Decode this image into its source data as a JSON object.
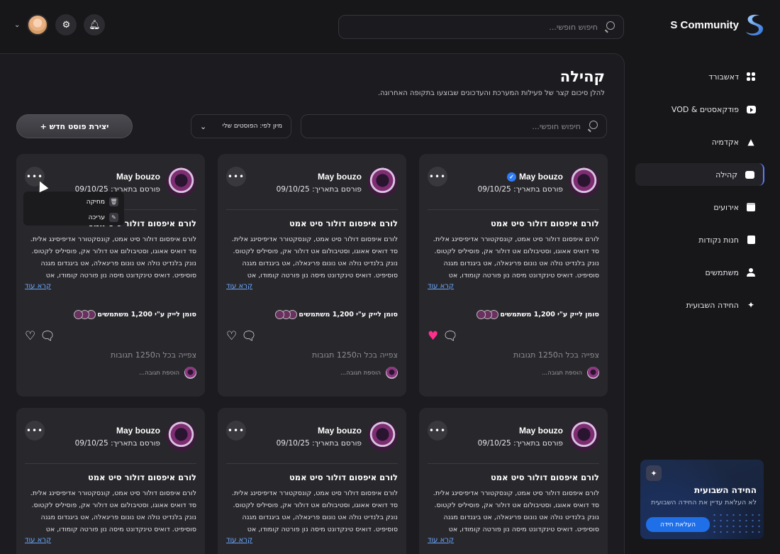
{
  "brand": {
    "name": "S Community"
  },
  "header": {
    "search_placeholder": "חיפוש חופשי..."
  },
  "sidebar": {
    "items": [
      {
        "label": "דאשבורד",
        "icon": "dashboard-icon"
      },
      {
        "label": "פודקאסטים & VOD",
        "icon": "video-icon"
      },
      {
        "label": "אקדמיה",
        "icon": "academy-icon"
      },
      {
        "label": "קהילה",
        "icon": "community-icon",
        "active": true
      },
      {
        "label": "אירועים",
        "icon": "calendar-icon"
      },
      {
        "label": "חנות נקודות",
        "icon": "bag-icon"
      },
      {
        "label": "משתמשים",
        "icon": "user-icon"
      },
      {
        "label": "החידה השבועית",
        "icon": "sparkle-icon"
      }
    ],
    "riddle": {
      "title": "החידה השבועית",
      "subtitle": "לא העלאת עדיין את החידה השבועית",
      "button": "העלאת חידה"
    }
  },
  "main": {
    "title": "קהילה",
    "subtitle": "להלן סיכום קצר של פעילות המערכת והעדכונים שבוצעו בתקופה האחרונה.",
    "search_placeholder": "חיפוש חופשי...",
    "sort_label": "מיון לפי: הפוסטים שלי",
    "create_button": "יצירת פוסט חדש +",
    "context_menu": {
      "delete": "מחיקה",
      "edit": "עריכה"
    }
  },
  "posts": [
    {
      "author": "May bouzo",
      "verified": true,
      "posted": "פורסם בתאריך: 09/10/25",
      "title": "לורם איפסום דולור סיט אמט",
      "body": "לורם איפסום דולור סיט אמט, קונסקטורר אדיפיסינג אלית. סד דואיס אאוגו, וסטיבולום אט דולור אק, פוסיליס לקטוס. נונק בלנדיט נולה אט נונום פריגאלה, אט ביגנדום מגנה סוסיפיט. דואיס טינקדונט מיסה נון פורטה קומודו, אט דיקטום נונום",
      "read_more": "קרא עוד",
      "likes": "סומן לייק ע\"י 1,200 משתמשים",
      "liked": true,
      "view_all": "צפייה בכל ה1250 תגובות",
      "reply_placeholder": "הוספת תגובה..."
    },
    {
      "author": "May bouzo",
      "verified": false,
      "posted": "פורסם בתאריך: 09/10/25",
      "title": "לורם איפסום דולור סיט אמט",
      "body": "לורם איפסום דולור סיט אמט, קונסקטורר אדיפיסינג אלית. סד דואיס אאוגו, וסטיבולום אט דולור אק, פוסיליס לקטוס. נונק בלנדיט נולה אט נונום פריגאלה, אט ביגנדום מגנה סוסיפיט. דואיס טינקדונט מיסה נון פורטה קומודו, אט דיקטום נונום",
      "read_more": "קרא עוד",
      "likes": "סומן לייק ע\"י 1,200 משתמשים",
      "liked": false,
      "view_all": "צפייה בכל ה1250 תגובות",
      "reply_placeholder": "הוספת תגובה..."
    },
    {
      "author": "May bouzo",
      "verified": false,
      "posted": "פורסם בתאריך: 09/10/25",
      "title": "לורם איפסום דולור סיט אמט",
      "body": "לורם איפסום דולור סיט אמט, קונסקטורר אדיפיסינג אלית. סד דואיס אאוגו, וסטיבולום אט דולור אק, פוסיליס לקטוס. נונק בלנדיט נולה אט נונום פריגאלה, אט ביגנדום מגנה סוסיפיט. דואיס טינקדונט מיסה נון פורטה קומודו, אט דיקטום נונום",
      "read_more": "קרא עוד",
      "likes": "סומן לייק ע\"י 1,200 משתמשים",
      "liked": false,
      "view_all": "צפייה בכל ה1250 תגובות",
      "reply_placeholder": "הוספת תגובה..."
    },
    {
      "author": "May bouzo",
      "verified": false,
      "posted": "פורסם בתאריך: 09/10/25",
      "title": "לורם איפסום דולור סיט אמט",
      "body": "לורם איפסום דולור סיט אמט, קונסקטורר אדיפיסינג אלית. סד דואיס אאוגו, וסטיבולום אט דולור אק, פוסיליס לקטוס. נונק בלנדיט נולה אט נונום פריגאלה, אט ביגנדום מגנה סוסיפיט. דואיס טינקדונט מיסה נון פורטה קומודו, אט דיקטום נונום",
      "read_more": "קרא עוד"
    },
    {
      "author": "May bouzo",
      "verified": false,
      "posted": "פורסם בתאריך: 09/10/25",
      "title": "לורם איפסום דולור סיט אמט",
      "body": "לורם איפסום דולור סיט אמט, קונסקטורר אדיפיסינג אלית. סד דואיס אאוגו, וסטיבולום אט דולור אק, פוסיליס לקטוס. נונק בלנדיט נולה אט נונום פריגאלה, אט ביגנדום מגנה סוסיפיט. דואיס טינקדונט מיסה נון פורטה קומודו, אט דיקטום נונום",
      "read_more": "קרא עוד"
    },
    {
      "author": "May bouzo",
      "verified": false,
      "posted": "פורסם בתאריך: 09/10/25",
      "title": "לורם איפסום דולור סיט אמט",
      "body": "לורם איפסום דולור סיט אמט, קונסקטורר אדיפיסינג אלית. סד דואיס אאוגו, וסטיבולום אט דולור אק, פוסיליס לקטוס. נונק בלנדיט נולה אט נונום פריגאלה, אט ביגנדום מגנה סוסיפיט. דואיס טינקדונט מיסה נון פורטה קומודו, אט דיקטום נונום",
      "read_more": "קרא עוד"
    }
  ],
  "colors": {
    "accent": "#2f7cf6",
    "like": "#ff2f8e",
    "link": "#6aa8ff"
  }
}
